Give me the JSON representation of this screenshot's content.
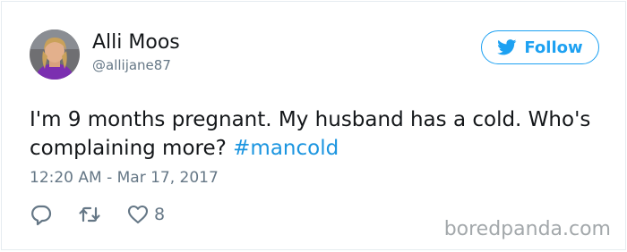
{
  "tweet": {
    "author": {
      "name": "Alli Moos",
      "handle": "@allijane87"
    },
    "follow_label": "Follow",
    "text_before": "I'm 9 months pregnant. My husband has a cold. Who's complaining more? ",
    "hashtag": "#mancold",
    "timestamp": "12:20 AM - Mar 17, 2017",
    "like_count": "8"
  },
  "watermark": "boredpanda.com",
  "colors": {
    "accent": "#1da1f2",
    "hashtag": "#1b95e0",
    "muted": "#657786",
    "text": "#14171a"
  },
  "icons": {
    "follow": "twitter-bird-icon",
    "reply": "reply-icon",
    "retweet": "retweet-icon",
    "like": "heart-icon"
  }
}
